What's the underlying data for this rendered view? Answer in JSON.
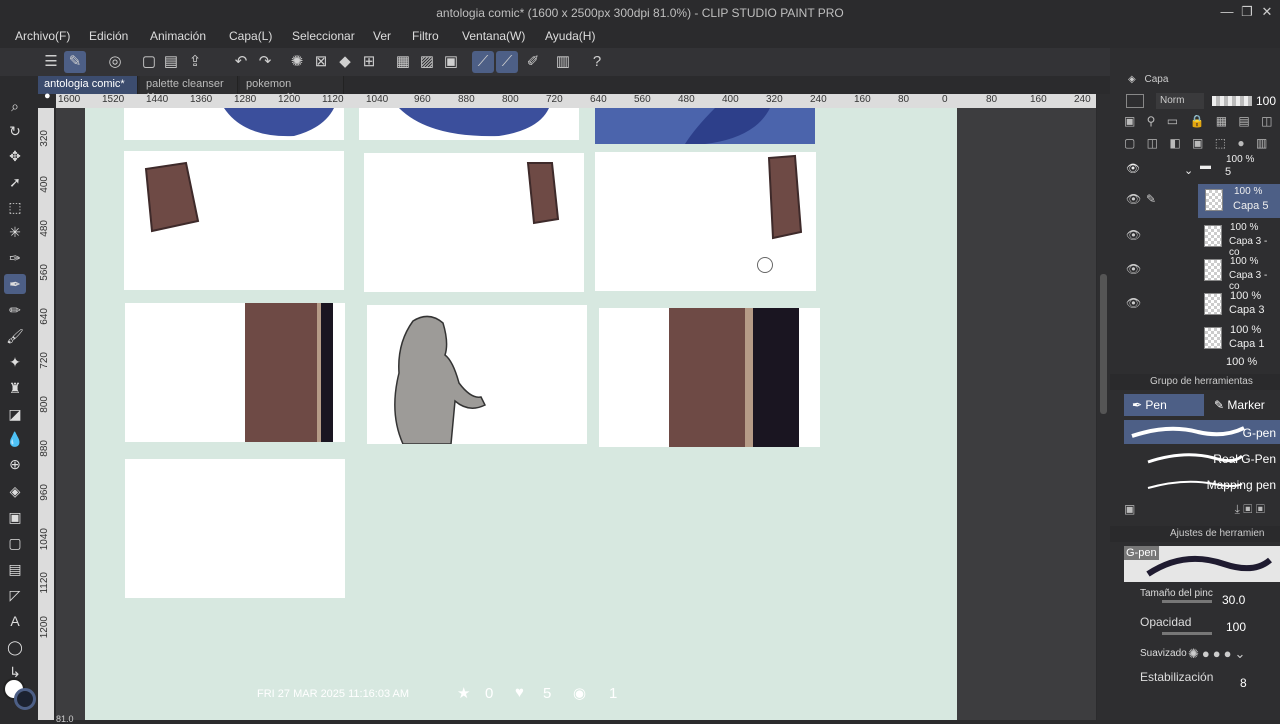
{
  "window": {
    "title": "antologia comic* (1600 x 2500px 300dpi 81.0%)  - CLIP STUDIO PAINT PRO"
  },
  "menu": [
    "Archivo(F)",
    "Edición",
    "Animación",
    "Capa(L)",
    "Seleccionar",
    "Ver",
    "Filtro",
    "Ventana(W)",
    "Ayuda(H)"
  ],
  "tabs": [
    {
      "label": "antologia comic*",
      "active": true
    },
    {
      "label": "palette cleanser"
    },
    {
      "label": "pokemon"
    }
  ],
  "ruler_h": [
    "1600",
    "1520",
    "1440",
    "1360",
    "1280",
    "1200",
    "1120",
    "1040",
    "960",
    "880",
    "800",
    "720",
    "640",
    "560",
    "480",
    "400",
    "320",
    "240",
    "160",
    "80",
    "0",
    "80",
    "160",
    "240"
  ],
  "ruler_v": [
    "320",
    "400",
    "480",
    "560",
    "640",
    "720",
    "800",
    "880",
    "960",
    "1040",
    "1120",
    "1200"
  ],
  "layers_panel": {
    "title": "Capa",
    "blend": "Norm",
    "opacity": "100",
    "layers": [
      {
        "pct": "100 %",
        "label": "5",
        "mode": "Nor"
      },
      {
        "pct": "100 %",
        "label": "Capa 5",
        "mode": "Nor",
        "selected": true
      },
      {
        "pct": "100 %",
        "label": "Capa 3 - co",
        "mode": ""
      },
      {
        "pct": "100 %",
        "label": "Capa 3 - co",
        "mode": ""
      },
      {
        "pct": "100 %",
        "label": "Capa 3",
        "mode": "Nor"
      },
      {
        "pct": "100 %",
        "label": "Capa 1",
        "mode": "Nor"
      },
      {
        "pct": "100 %",
        "label": "",
        "mode": "Nor"
      }
    ]
  },
  "tool_group": {
    "title": "Grupo de herramientas",
    "tabs": [
      "Pen",
      "Marker"
    ],
    "brushes": [
      "G-pen",
      "Real G-Pen",
      "Mapping pen"
    ]
  },
  "tool_settings": {
    "title": "Ajustes de herramien",
    "preset": "G-pen",
    "size_label": "Tamaño del pinc",
    "size_value": "30.0",
    "opacity_label": "Opacidad",
    "opacity_value": "100",
    "smoothing_label": "Suavizado",
    "stabilization_label": "Estabilización",
    "stabilization_value": "8"
  },
  "overlay": {
    "timestamp": "FRI 27 MAR 2025 11:16:03 AM",
    "stars": "0",
    "likes": "5",
    "views": "1"
  },
  "zoom": "81.0",
  "colors": {
    "bg": "#2b2b2d",
    "accent": "#4d5f86",
    "page": "#d7e8e0",
    "door": "#6e4a45",
    "blue": "#3b4f9c"
  }
}
